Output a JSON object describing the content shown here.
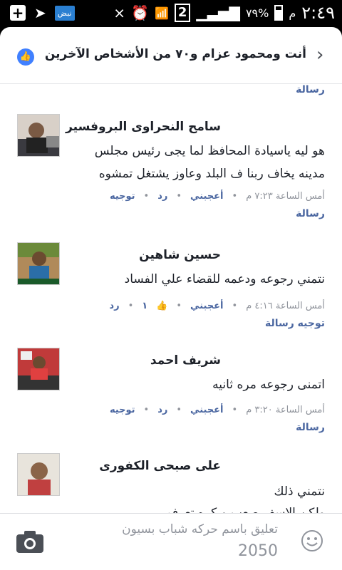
{
  "statusbar": {
    "app_badge": "نبض",
    "sim_label": "2",
    "battery": "٧٩%",
    "ampm": "م",
    "time": "٢:٤٩"
  },
  "header": {
    "title": "أنت ومحمود عزام و٧٠ من الأشخاص الآخرين"
  },
  "top_partial": {
    "message_label": "رسالة"
  },
  "comments": [
    {
      "name": "سامح النحراوى البروفسير",
      "text": "هو ليه ياسيادة المحافظ لما يجى رئيس مجلس مدينه يخاف ربنا ف البلد وعاوز يشتغل تمشوه",
      "time": "أمس الساعة ٧:٢٣ م",
      "like": "أعجبني",
      "reply": "رد",
      "forward": "توجيه",
      "message": "رسالة"
    },
    {
      "name": "حسين شاهين",
      "text": "نتمني رجوعه ودعمه للقضاء علي الفساد",
      "time": "أمس الساعة ٤:١٦ م",
      "like": "أعجبني",
      "like_count": "١",
      "reply": "رد",
      "forward_message": "توجيه رسالة"
    },
    {
      "name": "شريف احمد",
      "text": "اتمنى رجوعه مره ثانيه",
      "time": "أمس الساعة ٣:٢٠ م",
      "like": "أعجبني",
      "reply": "رد",
      "forward": "توجيه",
      "message": "رسالة"
    },
    {
      "name": "على صبحى الكفورى",
      "text_line1": "نتمني ذلك",
      "text_line2": "ولكن الاسف صعب وبكره تعرفو"
    }
  ],
  "composer": {
    "placeholder": "تعليق باسم حركه شباب بسيون",
    "draft": "2050"
  },
  "colors": {
    "link": "#4b67a1",
    "meta": "#90949c",
    "text": "#1d2129",
    "like_badge": "#4080ff"
  }
}
